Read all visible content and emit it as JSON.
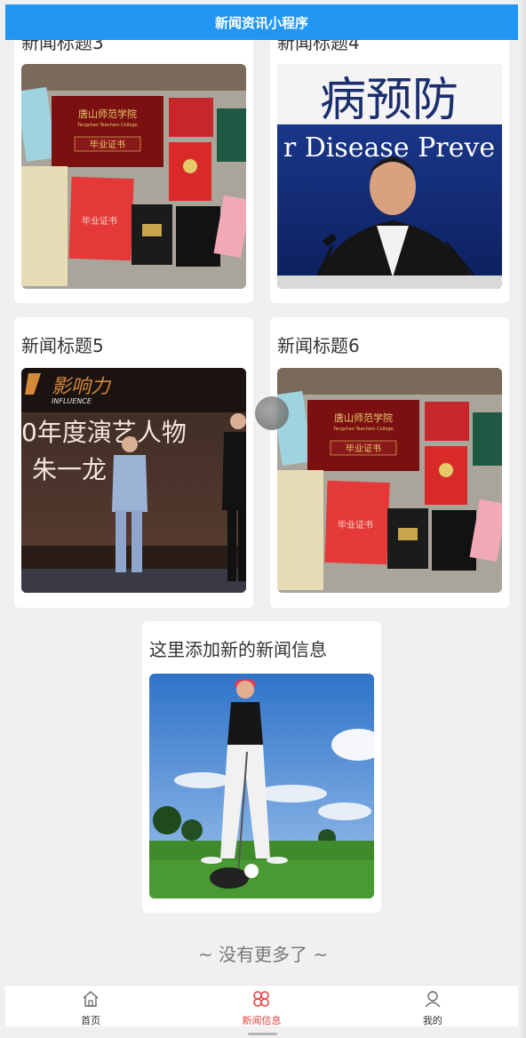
{
  "header": {
    "title": "新闻资讯小程序"
  },
  "cards": [
    {
      "title": "新闻标题3",
      "image": "certificates-photo"
    },
    {
      "title": "新闻标题4",
      "image": "press-conference-photo"
    },
    {
      "title": "新闻标题5",
      "image": "stage-event-photo"
    },
    {
      "title": "新闻标题6",
      "image": "certificates-photo"
    },
    {
      "title": "这里添加新的新闻信息",
      "image": "golf-player-photo"
    }
  ],
  "image_texts": {
    "college_cn": "唐山师范学院",
    "college_en": "Tangshan Teachers College",
    "diploma": "毕业证书",
    "banner_cn": "病预防",
    "banner_en": "r Disease Preve",
    "event_logo_cn": "影响力",
    "event_logo_en": "INFLUENCE",
    "event_line1": "0年度演艺人物",
    "event_line2": "朱一龙"
  },
  "footer": {
    "end_text": "~ 没有更多了 ~"
  },
  "tabbar": {
    "tabs": [
      {
        "label": "首页",
        "icon": "home-icon",
        "active": false
      },
      {
        "label": "新闻信息",
        "icon": "news-icon",
        "active": true
      },
      {
        "label": "我的",
        "icon": "user-icon",
        "active": false
      }
    ]
  },
  "colors": {
    "header_bg": "#2196f3",
    "active_tab": "#e64340",
    "page_bg": "#f0f0f0"
  }
}
